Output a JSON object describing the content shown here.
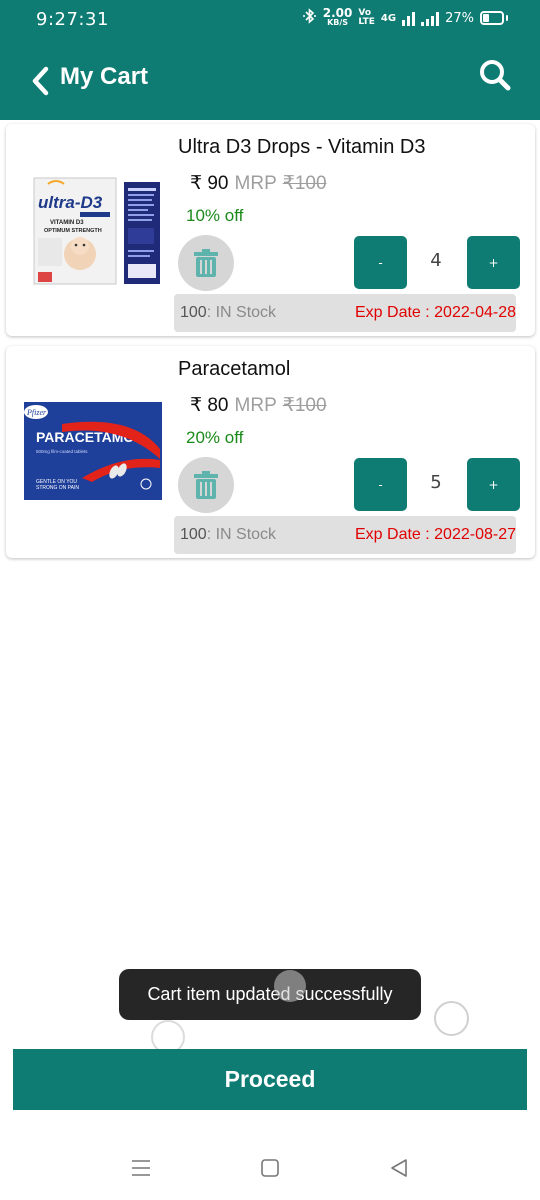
{
  "status_bar": {
    "time": "9:27:31",
    "net_speed_value": "2.00",
    "net_speed_unit": "KB/S",
    "volte_top": "Vo",
    "volte_bottom": "LTE",
    "network_type": "4G",
    "battery_percent": "27%"
  },
  "header": {
    "title": "My Cart",
    "back_icon": "chevron-left-icon",
    "search_icon": "search-icon"
  },
  "cart": {
    "items": [
      {
        "name": "Ultra D3 Drops - Vitamin D3",
        "price": "₹ 90",
        "mrp_label": "MRP",
        "mrp_value": "₹100",
        "discount": "10% off",
        "quantity": "4",
        "minus_label": "-",
        "plus_label": "+",
        "stock_count": "100",
        "stock_status": ": IN Stock",
        "exp_date": "Exp Date : 2022-04-28",
        "image_text_brand": "ultra-D3",
        "image_text_sub1": "VITAMIN D3",
        "image_text_sub2": "OPTIMUM STRENGTH"
      },
      {
        "name": "Paracetamol",
        "price": "₹ 80",
        "mrp_label": "MRP",
        "mrp_value": "₹100",
        "discount": "20% off",
        "quantity": "5",
        "minus_label": "-",
        "plus_label": "+",
        "stock_count": "100",
        "stock_status": ": IN Stock",
        "exp_date": "Exp Date : 2022-08-27",
        "image_text_brand": "Pfizer",
        "image_text_title": "PARACETAMOL",
        "image_text_sub": "500mg film-coated tablets",
        "image_text_tag1": "GENTLE ON YOU",
        "image_text_tag2": "STRONG ON PAIN"
      }
    ]
  },
  "toast": {
    "message": "Cart item updated successfully"
  },
  "proceed": {
    "label": "Proceed"
  },
  "colors": {
    "primary": "#0e7c73",
    "discount": "#1b8a1b",
    "expiry": "#e00000",
    "toast_bg": "#262626"
  }
}
